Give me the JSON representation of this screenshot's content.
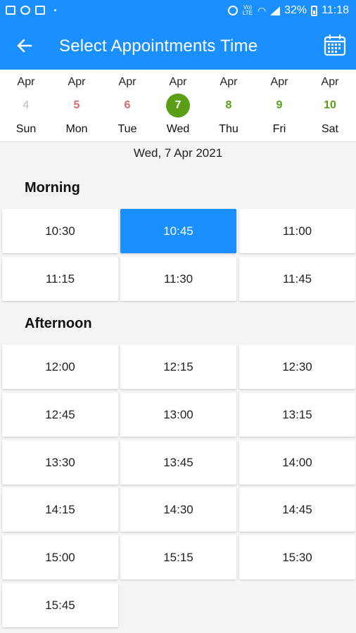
{
  "status_bar": {
    "battery": "32%",
    "time": "11:18",
    "volte": "Vo) LTE",
    "left_icons": [
      "gallery-icon",
      "settings-icon",
      "image-icon"
    ],
    "right_icons": [
      "alarm-icon",
      "volte-icon",
      "wifi-icon",
      "signal-icon",
      "battery-icon"
    ]
  },
  "app_bar": {
    "title": "Select Appointments Time",
    "back_icon": "arrow-left-icon",
    "calendar_icon": "calendar-icon",
    "background": "#1a8fff"
  },
  "week": [
    {
      "month": "Apr",
      "date": "4",
      "day": "Sun",
      "status": "past"
    },
    {
      "month": "Apr",
      "date": "5",
      "day": "Mon",
      "status": "unavailable"
    },
    {
      "month": "Apr",
      "date": "6",
      "day": "Tue",
      "status": "unavailable"
    },
    {
      "month": "Apr",
      "date": "7",
      "day": "Wed",
      "status": "selected"
    },
    {
      "month": "Apr",
      "date": "8",
      "day": "Thu",
      "status": "available"
    },
    {
      "month": "Apr",
      "date": "9",
      "day": "Fri",
      "status": "available"
    },
    {
      "month": "Apr",
      "date": "10",
      "day": "Sat",
      "status": "available"
    }
  ],
  "status_colors": {
    "past": "#bdbdbd",
    "unavailable": "#d9686e",
    "available": "#5a9e16",
    "selected": "#5a9e16"
  },
  "selected_date": "Wed, 7 Apr 2021",
  "morning": {
    "title": "Morning",
    "slots": [
      "10:30",
      "10:45",
      "11:00",
      "11:15",
      "11:30",
      "11:45"
    ]
  },
  "afternoon": {
    "title": "Afternoon",
    "slots": [
      "12:00",
      "12:15",
      "12:30",
      "12:45",
      "13:00",
      "13:15",
      "13:30",
      "13:45",
      "14:00",
      "14:15",
      "14:30",
      "14:45",
      "15:00",
      "15:15",
      "15:30",
      "15:45"
    ]
  },
  "selected_slot": "10:45"
}
